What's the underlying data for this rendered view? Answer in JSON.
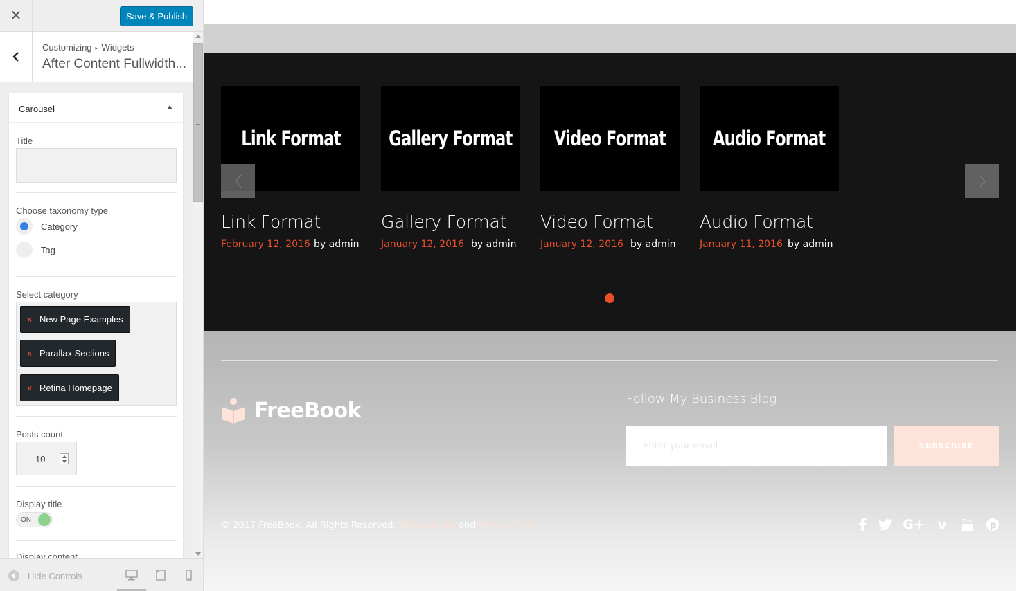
{
  "customizer": {
    "close_glyph": "✕",
    "publish_label": "Save & Publish",
    "breadcrumb": {
      "root": "Customizing",
      "arrow": "▸",
      "section": "Widgets"
    },
    "section_title": "After Content Fullwidth...",
    "widget": {
      "name": "Carousel",
      "title_label": "Title",
      "title_value": "",
      "taxonomy_label": "Choose taxonomy type",
      "taxonomy_options": [
        {
          "label": "Category",
          "checked": true
        },
        {
          "label": "Tag",
          "checked": false
        }
      ],
      "category_label": "Select category",
      "categories": [
        {
          "remove": "×",
          "label": "New Page Examples"
        },
        {
          "remove": "×",
          "label": "Parallax Sections"
        },
        {
          "remove": "×",
          "label": "Retina Homepage"
        }
      ],
      "posts_count_label": "Posts count",
      "posts_count_value": "10",
      "display_title_label": "Display title",
      "display_title_toggle": "ON",
      "display_content_label": "Display content"
    },
    "footer": {
      "hide_controls_label": "Hide Controls",
      "devices": [
        "desktop-icon",
        "tablet-icon",
        "mobile-icon"
      ]
    }
  },
  "preview": {
    "carousel": {
      "posts": [
        {
          "thumb_text": "Link Format",
          "title": "Link Format",
          "date": "February 12, 2016",
          "author": "by admin"
        },
        {
          "thumb_text": "Gallery Format",
          "title": "Gallery Format",
          "date": "January 12, 2016",
          "author": "by admin"
        },
        {
          "thumb_text": "Video Format",
          "title": "Video Format",
          "date": "January 12, 2016",
          "author": "by admin"
        },
        {
          "thumb_text": "Audio Format",
          "title": "Audio Format",
          "date": "January 11, 2016",
          "author": "by admin"
        }
      ],
      "active_dot": 1,
      "accent_color": "#e8502a"
    },
    "footer": {
      "logo_text": "FreeBook",
      "follow_heading": "Follow My Business Blog",
      "email_placeholder": "Enter your email",
      "subscribe_label": "SUBSCRIBE",
      "copyright": "© 2017 FreeBook. All Rights Reserved.",
      "terms_link": "Terms of use",
      "and_text": "and",
      "privacy_link": "Privacy Policy",
      "social_icons": [
        "facebook-icon",
        "twitter-icon",
        "google-plus-icon",
        "vimeo-icon",
        "youtube-icon",
        "pinterest-icon"
      ]
    }
  }
}
